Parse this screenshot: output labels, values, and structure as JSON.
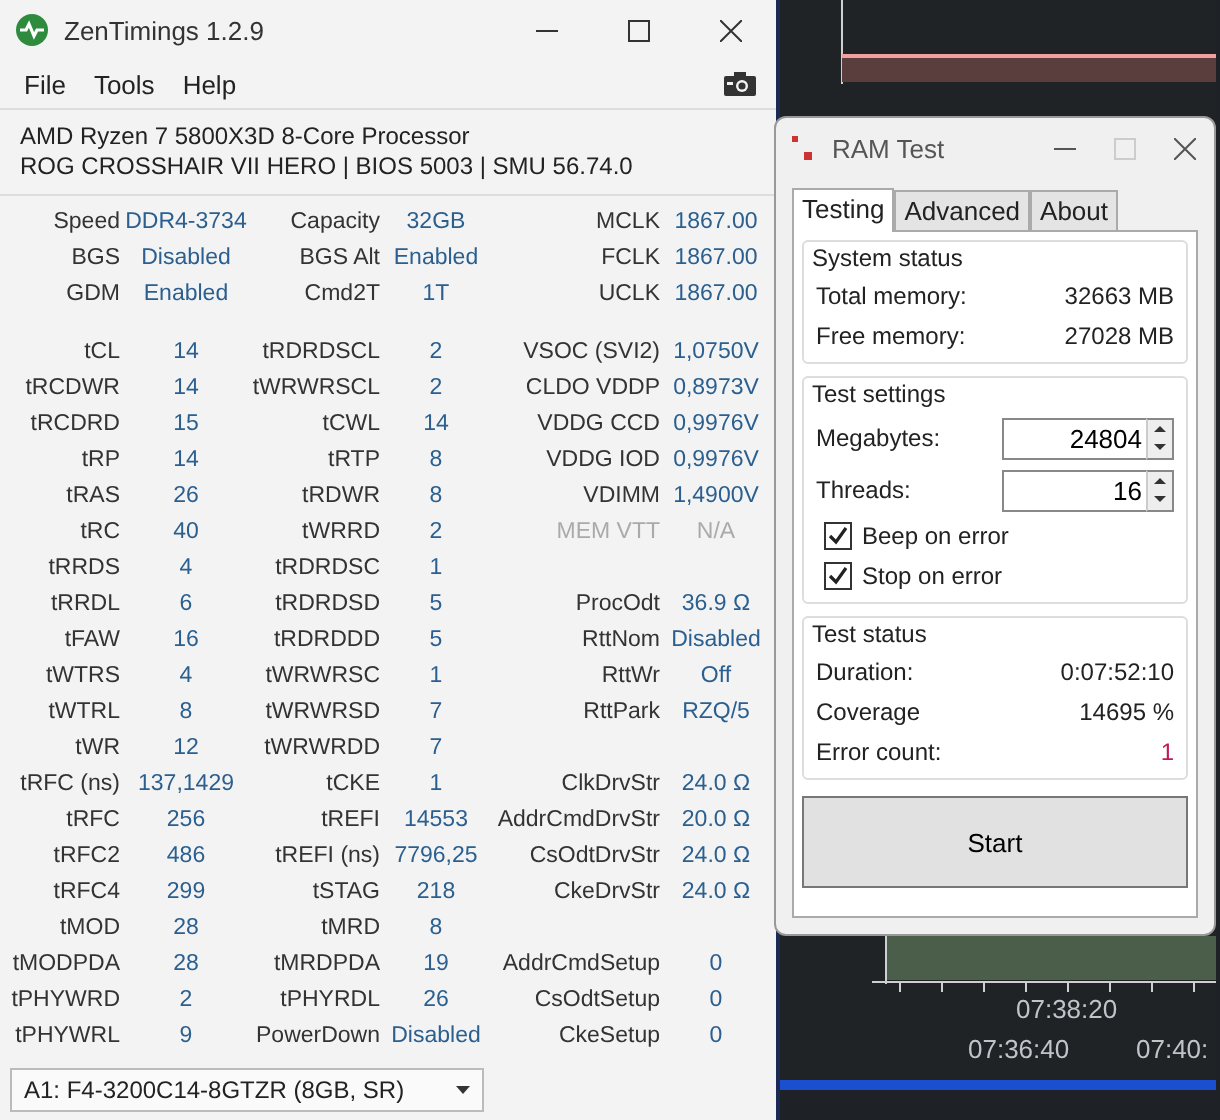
{
  "main_window": {
    "title": "ZenTimings 1.2.9",
    "menu": [
      "File",
      "Tools",
      "Help"
    ],
    "cpu": "AMD Ryzen 7 5800X3D 8-Core Processor",
    "board": "ROG CROSSHAIR VII HERO | BIOS 5003 | SMU 56.74.0",
    "summary_rows": [
      [
        {
          "label": "Speed",
          "value": "DDR4-3734",
          "disabled": false
        },
        {
          "label": "Capacity",
          "value": "32GB",
          "disabled": false
        },
        {
          "label": "MCLK",
          "value": "1867.00",
          "disabled": false
        }
      ],
      [
        {
          "label": "BGS",
          "value": "Disabled",
          "disabled": false
        },
        {
          "label": "BGS Alt",
          "value": "Enabled",
          "disabled": false
        },
        {
          "label": "FCLK",
          "value": "1867.00",
          "disabled": false
        }
      ],
      [
        {
          "label": "GDM",
          "value": "Enabled",
          "disabled": false
        },
        {
          "label": "Cmd2T",
          "value": "1T",
          "disabled": false
        },
        {
          "label": "UCLK",
          "value": "1867.00",
          "disabled": false
        }
      ]
    ],
    "timing_rows": [
      [
        {
          "label": "tCL",
          "value": "14",
          "disabled": false
        },
        {
          "label": "tRDRDSCL",
          "value": "2",
          "disabled": false
        },
        {
          "label": "VSOC (SVI2)",
          "value": "1,0750V",
          "disabled": false
        }
      ],
      [
        {
          "label": "tRCDWR",
          "value": "14",
          "disabled": false
        },
        {
          "label": "tWRWRSCL",
          "value": "2",
          "disabled": false
        },
        {
          "label": "CLDO VDDP",
          "value": "0,8973V",
          "disabled": false
        }
      ],
      [
        {
          "label": "tRCDRD",
          "value": "15",
          "disabled": false
        },
        {
          "label": "tCWL",
          "value": "14",
          "disabled": false
        },
        {
          "label": "VDDG CCD",
          "value": "0,9976V",
          "disabled": false
        }
      ],
      [
        {
          "label": "tRP",
          "value": "14",
          "disabled": false
        },
        {
          "label": "tRTP",
          "value": "8",
          "disabled": false
        },
        {
          "label": "VDDG IOD",
          "value": "0,9976V",
          "disabled": false
        }
      ],
      [
        {
          "label": "tRAS",
          "value": "26",
          "disabled": false
        },
        {
          "label": "tRDWR",
          "value": "8",
          "disabled": false
        },
        {
          "label": "VDIMM",
          "value": "1,4900V",
          "disabled": false
        }
      ],
      [
        {
          "label": "tRC",
          "value": "40",
          "disabled": false
        },
        {
          "label": "tWRRD",
          "value": "2",
          "disabled": false
        },
        {
          "label": "MEM VTT",
          "value": "N/A",
          "disabled": true
        }
      ],
      [
        {
          "label": "tRRDS",
          "value": "4",
          "disabled": false
        },
        {
          "label": "tRDRDSC",
          "value": "1",
          "disabled": false
        },
        null
      ],
      [
        {
          "label": "tRRDL",
          "value": "6",
          "disabled": false
        },
        {
          "label": "tRDRDSD",
          "value": "5",
          "disabled": false
        },
        {
          "label": "ProcOdt",
          "value": "36.9 Ω",
          "disabled": false
        }
      ],
      [
        {
          "label": "tFAW",
          "value": "16",
          "disabled": false
        },
        {
          "label": "tRDRDDD",
          "value": "5",
          "disabled": false
        },
        {
          "label": "RttNom",
          "value": "Disabled",
          "disabled": false
        }
      ],
      [
        {
          "label": "tWTRS",
          "value": "4",
          "disabled": false
        },
        {
          "label": "tWRWRSC",
          "value": "1",
          "disabled": false
        },
        {
          "label": "RttWr",
          "value": "Off",
          "disabled": false
        }
      ],
      [
        {
          "label": "tWTRL",
          "value": "8",
          "disabled": false
        },
        {
          "label": "tWRWRSD",
          "value": "7",
          "disabled": false
        },
        {
          "label": "RttPark",
          "value": "RZQ/5",
          "disabled": false
        }
      ],
      [
        {
          "label": "tWR",
          "value": "12",
          "disabled": false
        },
        {
          "label": "tWRWRDD",
          "value": "7",
          "disabled": false
        },
        null
      ],
      [
        {
          "label": "tRFC (ns)",
          "value": "137,1429",
          "disabled": false
        },
        {
          "label": "tCKE",
          "value": "1",
          "disabled": false
        },
        {
          "label": "ClkDrvStr",
          "value": "24.0 Ω",
          "disabled": false
        }
      ],
      [
        {
          "label": "tRFC",
          "value": "256",
          "disabled": false
        },
        {
          "label": "tREFI",
          "value": "14553",
          "disabled": false
        },
        {
          "label": "AddrCmdDrvStr",
          "value": "20.0 Ω",
          "disabled": false
        }
      ],
      [
        {
          "label": "tRFC2",
          "value": "486",
          "disabled": false
        },
        {
          "label": "tREFI (ns)",
          "value": "7796,25",
          "disabled": false
        },
        {
          "label": "CsOdtDrvStr",
          "value": "24.0 Ω",
          "disabled": false
        }
      ],
      [
        {
          "label": "tRFC4",
          "value": "299",
          "disabled": false
        },
        {
          "label": "tSTAG",
          "value": "218",
          "disabled": false
        },
        {
          "label": "CkeDrvStr",
          "value": "24.0 Ω",
          "disabled": false
        }
      ],
      [
        {
          "label": "tMOD",
          "value": "28",
          "disabled": false
        },
        {
          "label": "tMRD",
          "value": "8",
          "disabled": false
        },
        null
      ],
      [
        {
          "label": "tMODPDA",
          "value": "28",
          "disabled": false
        },
        {
          "label": "tMRDPDA",
          "value": "19",
          "disabled": false
        },
        {
          "label": "AddrCmdSetup",
          "value": "0",
          "disabled": false
        }
      ],
      [
        {
          "label": "tPHYWRD",
          "value": "2",
          "disabled": false
        },
        {
          "label": "tPHYRDL",
          "value": "26",
          "disabled": false
        },
        {
          "label": "CsOdtSetup",
          "value": "0",
          "disabled": false
        }
      ],
      [
        {
          "label": "tPHYWRL",
          "value": "9",
          "disabled": false
        },
        {
          "label": "PowerDown",
          "value": "Disabled",
          "disabled": false
        },
        {
          "label": "CkeSetup",
          "value": "0",
          "disabled": false
        }
      ]
    ],
    "module_select": "A1: F4-3200C14-8GTZR (8GB, SR)"
  },
  "background_chart": {
    "time_labels": [
      "07:38:20",
      "07:36:40",
      "07:40:"
    ]
  },
  "ram_test": {
    "title": "RAM Test",
    "tabs": [
      {
        "label": "Testing",
        "selected": true
      },
      {
        "label": "Advanced",
        "selected": false
      },
      {
        "label": "About",
        "selected": false
      }
    ],
    "system_status": {
      "title": "System status",
      "rows": [
        {
          "label": "Total memory:",
          "value": "32663 MB"
        },
        {
          "label": "Free memory:",
          "value": "27028 MB"
        }
      ]
    },
    "test_settings": {
      "title": "Test settings",
      "fields": [
        {
          "label": "Megabytes:",
          "value": "24804"
        },
        {
          "label": "Threads:",
          "value": "16"
        }
      ],
      "checkboxes": [
        {
          "label": "Beep on error",
          "checked": true
        },
        {
          "label": "Stop on error",
          "checked": true
        }
      ]
    },
    "test_status": {
      "title": "Test status",
      "rows": [
        {
          "label": "Duration:",
          "value": "0:07:52:10",
          "alert": false
        },
        {
          "label": "Coverage",
          "value": "14695 %",
          "alert": false
        },
        {
          "label": "Error count:",
          "value": "1",
          "alert": true
        }
      ]
    },
    "start_button": "Start"
  }
}
